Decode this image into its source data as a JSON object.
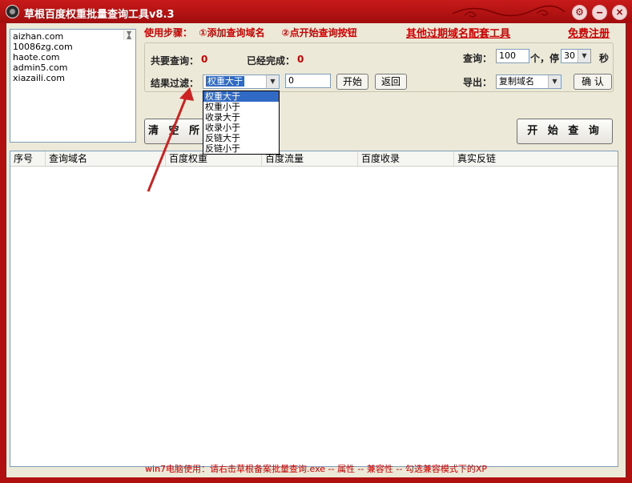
{
  "window": {
    "title": "草根百度权重批量查询工具v8.3",
    "minimize": "‒",
    "close": "×"
  },
  "domains": [
    "aizhan.com",
    "10086zg.com",
    "haote.com",
    "admin5.com",
    "xiazaili.com"
  ],
  "steps": {
    "text": "使用步骤：  ①添加查询域名     ②点开始查询按钮"
  },
  "links": {
    "other_tools": "其他过期域名配套工具",
    "register": "免费注册"
  },
  "stats": {
    "total_label": "共要查询：",
    "total_value": "0",
    "done_label": "已经完成：",
    "done_value": "0"
  },
  "query": {
    "label": "查询：",
    "count": "100",
    "unit": "个，停",
    "pause": "30",
    "sec": "秒"
  },
  "filter": {
    "label": "结果过滤：",
    "selected": "权重大于",
    "value": "0",
    "start": "开始",
    "back": "返回",
    "options": [
      "权重大于",
      "权重小于",
      "收录大于",
      "收录小于",
      "反链大于",
      "反链小于"
    ]
  },
  "export": {
    "label": "导出：",
    "selected": "复制域名",
    "confirm": "确 认"
  },
  "buttons": {
    "clear": "清 空 所",
    "start_query": "开 始 查 询"
  },
  "table": {
    "columns": [
      "序号",
      "查询域名",
      "百度权重",
      "百度流量",
      "百度收录",
      "真实反链"
    ]
  },
  "footer": {
    "text": "win7电脑使用：请右击草根备案批量查询.exe -- 属性 -- 兼容性 -- 勾选兼容模式下的XP"
  },
  "colors": {
    "title_red": "#b01010",
    "accent_red": "#cc0000",
    "highlight": "#316ac5"
  }
}
